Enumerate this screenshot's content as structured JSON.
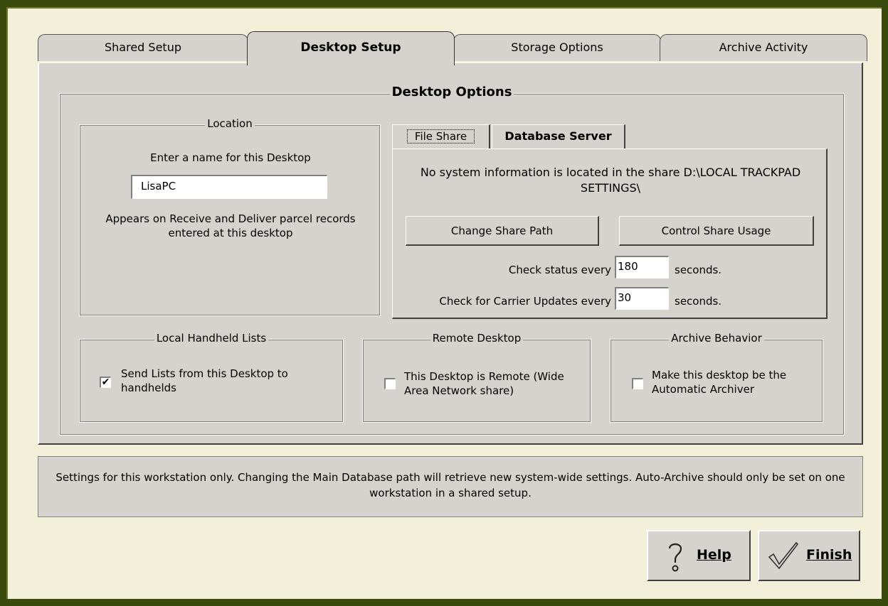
{
  "tabs": [
    {
      "label": "Shared Setup"
    },
    {
      "label": "Desktop Setup"
    },
    {
      "label": "Storage Options"
    },
    {
      "label": "Archive Activity"
    }
  ],
  "desktop_options": {
    "title": "Desktop Options",
    "location": {
      "title": "Location",
      "prompt": "Enter a name for this Desktop",
      "name_value": "LisaPC",
      "note": "Appears on Receive and Deliver parcel records entered at this desktop"
    },
    "inner_tabs": [
      {
        "label": "File Share"
      },
      {
        "label": "Database Server"
      }
    ],
    "file_share": {
      "message": "No system information is located in the share D:\\LOCAL TRACKPAD SETTINGS\\",
      "change_share_path_label": "Change Share Path",
      "control_share_usage_label": "Control Share Usage",
      "check_status_label": "Check status every",
      "check_status_value": "180",
      "carrier_updates_label": "Check for Carrier Updates every",
      "carrier_updates_value": "30",
      "seconds_label": "seconds."
    },
    "local_handheld": {
      "title": "Local Handheld Lists",
      "checkbox_label": "Send Lists from this Desktop to handhelds",
      "checked": true
    },
    "remote_desktop": {
      "title": "Remote Desktop",
      "checkbox_label": "This Desktop is Remote (Wide Area Network share)",
      "checked": false
    },
    "archive_behavior": {
      "title": "Archive Behavior",
      "checkbox_label": "Make this desktop be the Automatic Archiver",
      "checked": false
    }
  },
  "status_text": "Settings for this workstation only.  Changing the Main Database path will retrieve new system-wide settings. Auto-Archive should only be set on one workstation in a shared setup.",
  "buttons": {
    "help_label": "Help",
    "finish_label": "Finish"
  },
  "icons": {
    "help": "question-mark-icon",
    "finish": "checkmark-icon",
    "checkbox_check": "✔"
  }
}
